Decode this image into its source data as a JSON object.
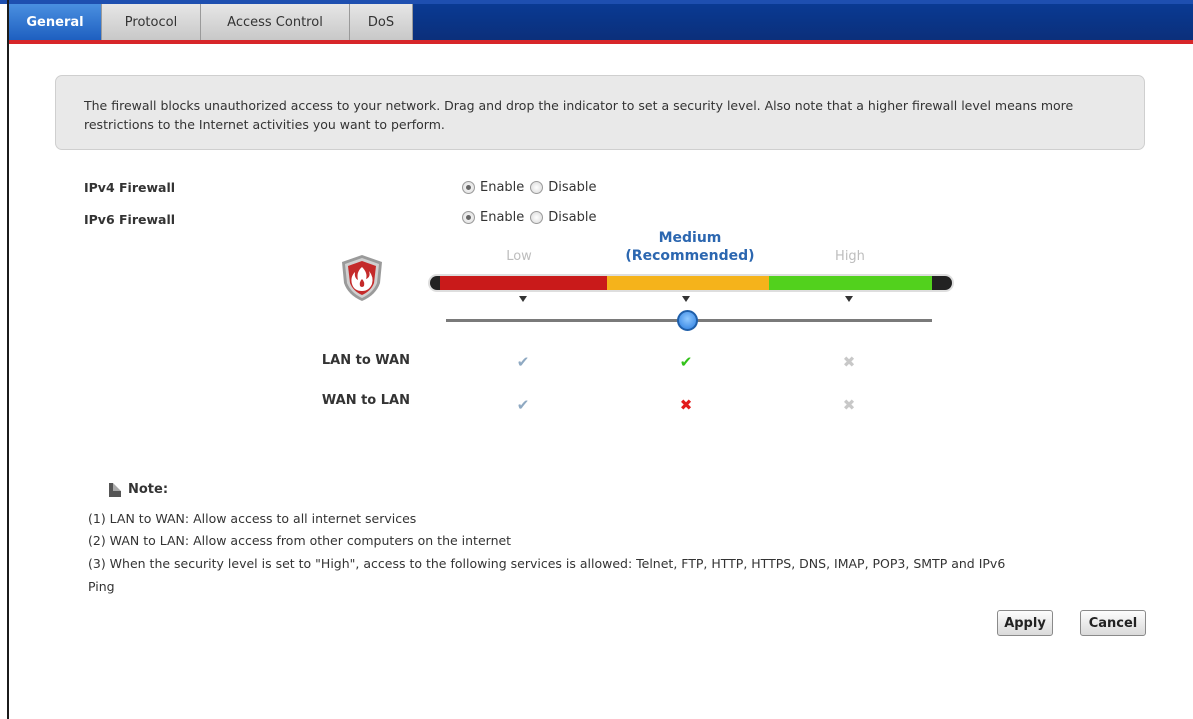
{
  "tabs": [
    {
      "label": "General",
      "active": true
    },
    {
      "label": "Protocol",
      "active": false
    },
    {
      "label": "Access Control",
      "active": false
    },
    {
      "label": "DoS",
      "active": false
    }
  ],
  "description": "The firewall blocks unauthorized access to your network. Drag and drop the indicator to set a security level. Also note that a higher firewall level means more restrictions to the Internet activities you want to perform.",
  "settings": {
    "ipv4": {
      "label": "IPv4 Firewall",
      "enable": "Enable",
      "disable": "Disable",
      "selected": "Enable"
    },
    "ipv6": {
      "label": "IPv6 Firewall",
      "enable": "Enable",
      "disable": "Disable",
      "selected": "Enable"
    }
  },
  "security_level": {
    "levels": [
      "Low",
      "Medium",
      "High"
    ],
    "medium_line1": "Medium",
    "medium_line2": "(Recommended)",
    "selected": "Medium",
    "colors": {
      "low": "#c91a1a",
      "medium": "#f5b31b",
      "high": "#52d11d",
      "accent": "#2c67b0"
    }
  },
  "traffic": {
    "lan_to_wan": {
      "label": "LAN to WAN",
      "low": "check",
      "medium": "check",
      "high": "x"
    },
    "wan_to_lan": {
      "label": "WAN to LAN",
      "low": "check",
      "medium": "x",
      "high": "x"
    }
  },
  "note": {
    "title": "Note:",
    "lines": [
      "(1) LAN to WAN: Allow access to all internet services",
      "(2) WAN to LAN: Allow access from other computers on the internet",
      "(3) When the security level is set to \"High\", access to the following services is allowed: Telnet, FTP, HTTP, HTTPS, DNS, IMAP, POP3, SMTP and IPv6",
      "Ping"
    ]
  },
  "buttons": {
    "apply": "Apply",
    "cancel": "Cancel"
  },
  "icons": {
    "shield": "firewall-shield-icon",
    "note": "document-icon",
    "check": "✔",
    "x": "✖"
  }
}
